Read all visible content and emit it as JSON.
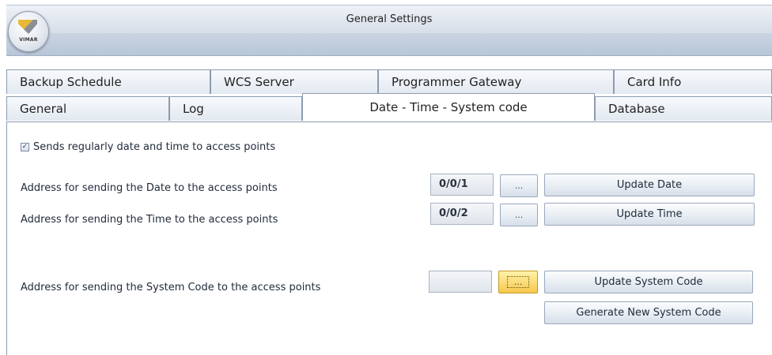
{
  "window": {
    "title": "General Settings",
    "logo_text": "VIMAR"
  },
  "tabs_row1": [
    {
      "label": "Backup Schedule"
    },
    {
      "label": "WCS Server"
    },
    {
      "label": "Programmer Gateway"
    },
    {
      "label": "Card Info"
    }
  ],
  "tabs_row2": [
    {
      "label": "General"
    },
    {
      "label": "Log"
    },
    {
      "label": "Date - Time - System code",
      "active": true
    },
    {
      "label": "Database"
    }
  ],
  "settings": {
    "send_regularly": {
      "label": "Sends regularly date and time to access points",
      "checked": true
    },
    "date": {
      "label": "Address for sending the Date to the access points",
      "value": "0/0/1",
      "browse_label": "...",
      "update_label": "Update Date"
    },
    "time": {
      "label": "Address for sending the Time to the access points",
      "value": "0/0/2",
      "browse_label": "...",
      "update_label": "Update Time"
    },
    "system_code": {
      "label": "Address for sending the System Code to the access points",
      "value": "",
      "browse_label": "...",
      "update_label": "Update System Code",
      "generate_label": "Generate New System Code"
    }
  },
  "colors": {
    "focus_accent": "#f6c84c",
    "tab_border": "#8d9bb0"
  },
  "icons": {
    "check": "✓"
  }
}
